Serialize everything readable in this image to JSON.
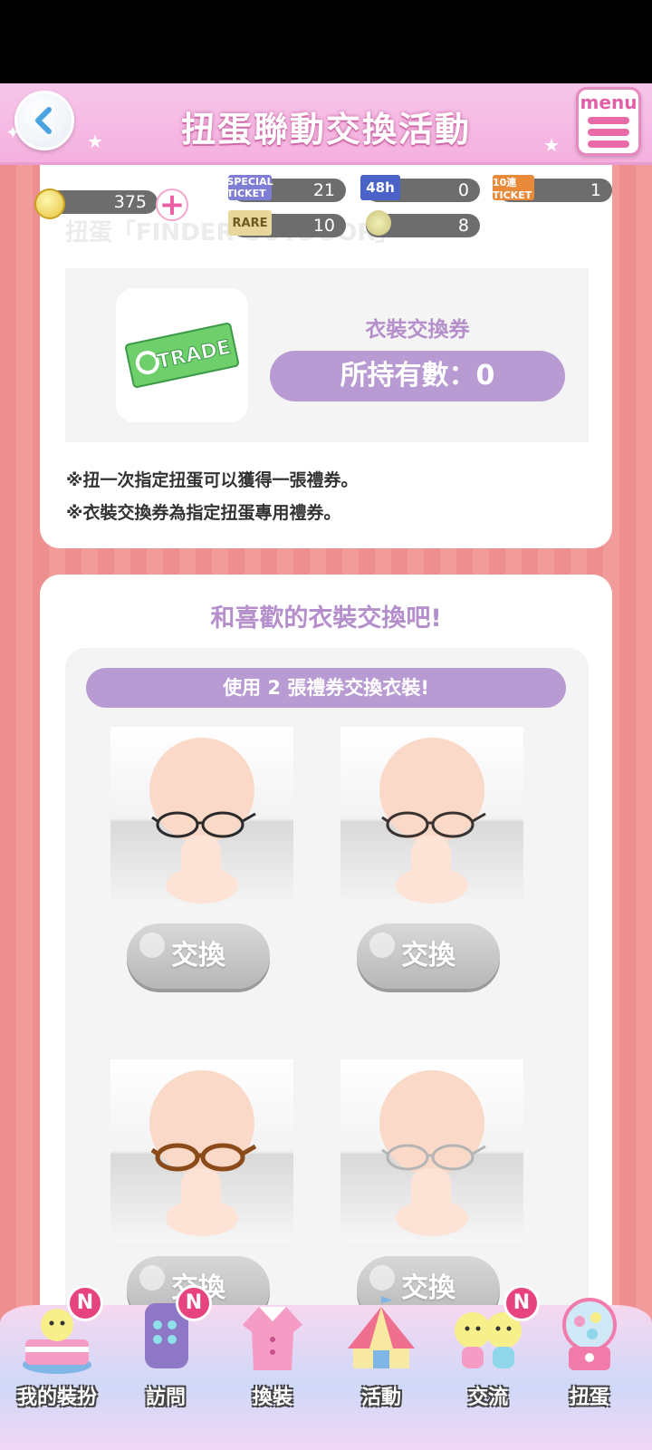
{
  "header": {
    "title": "扭蛋聯動交換活動",
    "menu_label": "menu"
  },
  "currency": {
    "coins": "375",
    "tickets": [
      {
        "icon_text": "SPECIAL TICKET",
        "count": "21"
      },
      {
        "icon_text": "48h",
        "count": "0"
      },
      {
        "icon_text": "10連 TICKET",
        "count": "1"
      },
      {
        "icon_text": "RARE",
        "count": "10"
      },
      {
        "icon_text": "",
        "count": "8"
      }
    ]
  },
  "ticket_section": {
    "ghost_text": "扭蛋「FINDER OUTDOOR」",
    "ticket_image_text": "TRADE",
    "ticket_name": "衣裝交換券",
    "owned_count": "所持有數：0",
    "notes": [
      "※扭一次指定扭蛋可以獲得一張禮券。",
      "※衣裝交換券為指定扭蛋專用禮券。"
    ]
  },
  "exchange_section": {
    "title": "和喜歡的衣裝交換吧!",
    "use_label": "使用 2 張禮券交換衣裝!",
    "items": [
      {
        "glasses_color": "#2a2a2a",
        "button": "交換"
      },
      {
        "glasses_color": "#3a3230",
        "button": "交換"
      },
      {
        "glasses_color": "#8a4a1a",
        "button": "交換"
      },
      {
        "glasses_color": "#b5b5b5",
        "button": "交換"
      }
    ]
  },
  "nav": {
    "items": [
      {
        "label": "我的裝扮",
        "badge": "N"
      },
      {
        "label": "訪問",
        "badge": "N"
      },
      {
        "label": "換裝",
        "badge": ""
      },
      {
        "label": "活動",
        "badge": ""
      },
      {
        "label": "交流",
        "badge": "N"
      },
      {
        "label": "扭蛋",
        "badge": ""
      }
    ]
  },
  "colors": {
    "accent_purple": "#b99bd3",
    "header_pink": "#f5b0df",
    "badge_pink": "#e6437f"
  }
}
